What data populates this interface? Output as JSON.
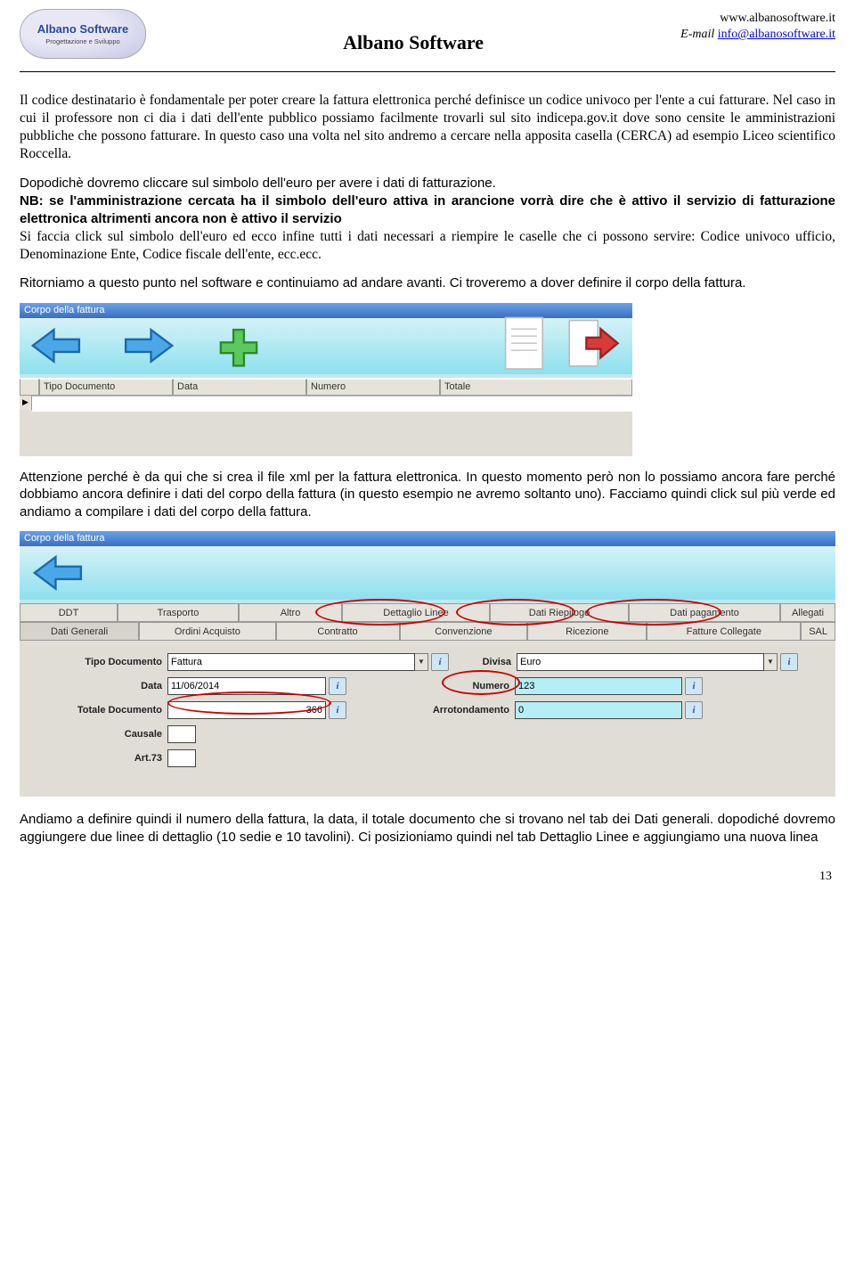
{
  "header": {
    "logo_line1": "Albano Software",
    "logo_line2": "Progettazione e Sviluppo",
    "brand": "Albano Software",
    "url": "www.albanosoftware.it",
    "email_label": "E-mail",
    "email": "info@albanosoftware.it"
  },
  "para1": "Il codice destinatario è fondamentale per poter creare la fattura elettronica perché definisce un codice univoco per l'ente a cui fatturare. Nel caso in cui il professore non ci dia i dati dell'ente pubblico possiamo facilmente trovarli sul sito indicepa.gov.it dove sono censite le amministrazioni pubbliche che possono fatturare. In questo caso una volta nel sito andremo a cercare nella apposita casella (CERCA) ad esempio Liceo scientifico Roccella.",
  "para2a": "Dopodichè  dovremo cliccare sul simbolo dell'euro per avere i dati di fatturazione.",
  "para2b": "NB: se l'amministrazione cercata ha il simbolo dell'euro attiva in arancione vorrà dire che è attivo il servizio di fatturazione elettronica altrimenti ancora non è attivo il servizio",
  "para2c": "Si faccia click sul simbolo dell'euro ed ecco infine tutti i dati necessari a riempire le caselle che ci possono servire: Codice univoco ufficio, Denominazione Ente, Codice fiscale dell'ente, ecc.ecc.",
  "para3": "Ritorniamo a questo punto nel software e continuiamo ad andare avanti. Ci troveremo a dover definire il corpo della fattura.",
  "ss1": {
    "title": "Corpo della fattura",
    "cols": [
      "Tipo Documento",
      "Data",
      "Numero",
      "Totale"
    ]
  },
  "para4": "Attenzione perché  è da qui che si crea il file xml per la fattura elettronica. In questo momento però non lo possiamo ancora fare perché dobbiamo ancora definire i dati del corpo della fattura (in questo esempio ne avremo soltanto uno). Facciamo quindi click sul più verde ed andiamo a compilare i dati del corpo della fattura.",
  "ss2": {
    "title": "Corpo della fattura",
    "tabs_top": [
      "DDT",
      "Trasporto",
      "Altro",
      "Dettaglio Linee",
      "Dati Riepilogo",
      "Dati pagamento",
      "Allegati"
    ],
    "tabs_bot": [
      "Dati Generali",
      "Ordini Acquisto",
      "Contratto",
      "Convenzione",
      "Ricezione",
      "Fatture Collegate",
      "SAL"
    ],
    "fields": {
      "tipo_doc_label": "Tipo Documento",
      "tipo_doc_val": "Fattura",
      "divisa_label": "Divisa",
      "divisa_val": "Euro",
      "data_label": "Data",
      "data_val": "11/06/2014",
      "numero_label": "Numero",
      "numero_val": "123",
      "totale_label": "Totale Documento",
      "totale_val": "366",
      "arrot_label": "Arrotondamento",
      "arrot_val": "0",
      "causale_label": "Causale",
      "art73_label": "Art.73"
    }
  },
  "para5": "Andiamo a definire quindi il numero della fattura, la data, il totale documento che si trovano nel tab dei Dati generali. dopodiché dovremo aggiungere due linee di dettaglio (10 sedie e 10 tavolini). Ci posizioniamo quindi nel tab Dettaglio Linee e aggiungiamo una nuova linea",
  "page_num": "13"
}
